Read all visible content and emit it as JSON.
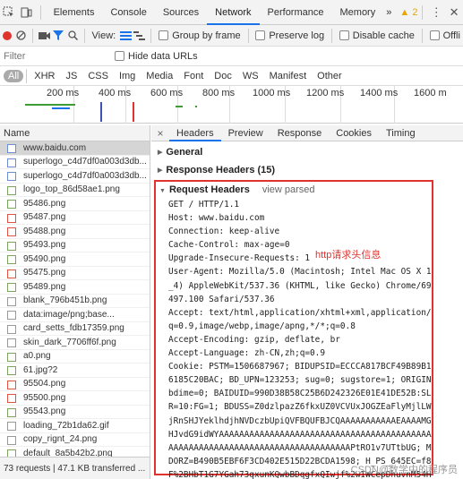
{
  "panel_tabs": [
    "Elements",
    "Console",
    "Sources",
    "Network",
    "Performance",
    "Memory"
  ],
  "more_tabs": "»",
  "warning_count": "2",
  "toolbar": {
    "view_label": "View:",
    "group_by_frame": "Group by frame",
    "preserve_log": "Preserve log",
    "disable_cache": "Disable cache",
    "offline": "Offli"
  },
  "filter": {
    "placeholder": "Filter",
    "hide_data_urls": "Hide data URLs"
  },
  "types": [
    "All",
    "XHR",
    "JS",
    "CSS",
    "Img",
    "Media",
    "Font",
    "Doc",
    "WS",
    "Manifest",
    "Other"
  ],
  "timeline_ticks": [
    "200 ms",
    "400 ms",
    "600 ms",
    "800 ms",
    "1000 ms",
    "1200 ms",
    "1400 ms",
    "1600 m"
  ],
  "list_header": "Name",
  "requests": [
    {
      "name": "www.baidu.com",
      "icon": "doc"
    },
    {
      "name": "superlogo_c4d7df0a003d3db...",
      "icon": "doc"
    },
    {
      "name": "superlogo_c4d7df0a003d3db...",
      "icon": "doc"
    },
    {
      "name": "logo_top_86d58ae1.png",
      "icon": "img"
    },
    {
      "name": "95486.png",
      "icon": "img"
    },
    {
      "name": "95487.png",
      "icon": "red"
    },
    {
      "name": "95488.png",
      "icon": "red"
    },
    {
      "name": "95493.png",
      "icon": "img"
    },
    {
      "name": "95490.png",
      "icon": "img"
    },
    {
      "name": "95475.png",
      "icon": "red"
    },
    {
      "name": "95489.png",
      "icon": "img"
    },
    {
      "name": "blank_796b451b.png",
      "icon": "none"
    },
    {
      "name": "data:image/png;base...",
      "icon": "none"
    },
    {
      "name": "card_setts_fdb17359.png",
      "icon": "none"
    },
    {
      "name": "skin_dark_7706ff6f.png",
      "icon": "none"
    },
    {
      "name": "a0.png",
      "icon": "img"
    },
    {
      "name": "61.jpg?2",
      "icon": "img"
    },
    {
      "name": "95504.png",
      "icon": "red"
    },
    {
      "name": "95500.png",
      "icon": "red"
    },
    {
      "name": "95543.png",
      "icon": "img"
    },
    {
      "name": "loading_72b1da62.gif",
      "icon": "none"
    },
    {
      "name": "copy_rignt_24.png",
      "icon": "none"
    },
    {
      "name": "default_8a5b42b2.png",
      "icon": "img"
    }
  ],
  "status_bar": "73 requests | 47.1 KB transferred ...",
  "detail_tabs": [
    "Headers",
    "Preview",
    "Response",
    "Cookies",
    "Timing"
  ],
  "close_symbol": "×",
  "sections": {
    "general": "General",
    "response_headers": "Response Headers (15)",
    "request_headers": "Request Headers",
    "view_parsed": "view parsed"
  },
  "annotation": "http请求头信息",
  "request_header_lines": [
    "GET / HTTP/1.1",
    "Host: www.baidu.com",
    "Connection: keep-alive",
    "Cache-Control: max-age=0",
    "Upgrade-Insecure-Requests: 1",
    "User-Agent: Mozilla/5.0 (Macintosh; Intel Mac OS X 10_12",
    "_4) AppleWebKit/537.36 (KHTML, like Gecko) Chrome/69.0.3",
    "497.100 Safari/537.36",
    "Accept: text/html,application/xhtml+xml,application/xml;",
    "q=0.9,image/webp,image/apng,*/*;q=0.8",
    "Accept-Encoding: gzip, deflate, br",
    "Accept-Language: zh-CN,zh;q=0.9",
    "Cookie: PSTM=1506687967; BIDUPSID=ECCCA817BCF49B89B1F19C",
    "6185C20BAC; BD_UPN=123253; sug=0; sugstore=1; ORIGIN=0;",
    "bdime=0; BAIDUID=990D38B58C25B6D242326E01E41DE52B:SL=0:N",
    "R=10:FG=1; BDUSS=Z0dzlpazZ6fkxUZ0VCVUxJOGZEaFlyMjlLWElse",
    "jRnSHJYeklhdjhNVDczbUpiQVFBQUFBJCQAAAAAAAAAAAEAAAAMGd9Gc",
    "HJvdG9idWYAAAAAAAAAAAAAAAAAAAAAAAAAAAAAAAAAAAAAAAAAAAAAA",
    "AAAAAAAAAAAAAAAAAAAAAAAAAAAAAAAAAAAAPtRO1v7UTtbUG; MCITY=-%3A; B",
    "DORZ=B490B5EBF6F3CD402E515D22BCDA1598; H_PS_645EC=f84bV",
    "F%2BHbT1G7YGah73qxunKQwbBDqgfxQIwjf%2wIWCepDhuvnM54HD"
  ],
  "watermark": "CSDN@数学中的程序员"
}
